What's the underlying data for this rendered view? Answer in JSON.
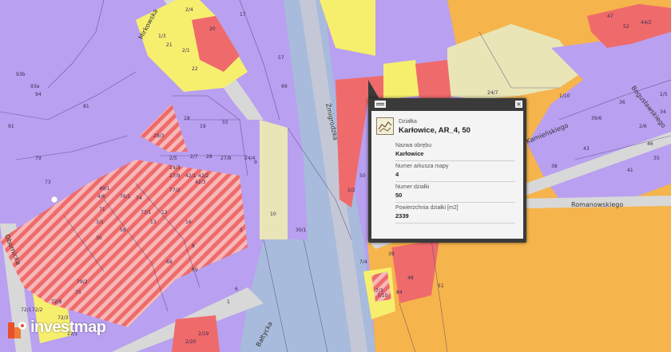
{
  "popup": {
    "kind": "Działka",
    "title": "Karłowice, AR_4, 50",
    "fields": [
      {
        "label": "Nazwa obrębu",
        "value": "Karłowice"
      },
      {
        "label": "Numer arkusza mapy",
        "value": "4"
      },
      {
        "label": "Numer działki",
        "value": "50"
      },
      {
        "label": "Powierzchnia działki [m2]",
        "value": "2339"
      }
    ],
    "close_glyph": "×"
  },
  "logo": {
    "brand": "investmap"
  },
  "streets": {
    "mirkowska": "Mirkowska",
    "zmigrodzka": "Żmigrodzka",
    "kamienskiego": "Kamieńskiego",
    "boguslawskiego": "Bogusławskiego",
    "romanowskiego": "Romanowskiego",
    "obornicka": "Obornicka",
    "baltycka": "Bałtycka"
  },
  "parcel_labels": [
    "2/4",
    "1/3",
    "20",
    "17",
    "21",
    "22",
    "2/1",
    "57",
    "69",
    "93b",
    "93a",
    "94",
    "81",
    "91",
    "79",
    "73",
    "72/2",
    "72/1",
    "7/3",
    "18",
    "19",
    "29/3",
    "55",
    "2/5",
    "2/7",
    "28",
    "27/8",
    "24/4",
    "24/3",
    "27/9",
    "42/1",
    "42/2",
    "42/3",
    "49/1",
    "4/6",
    "76/1",
    "74",
    "71",
    "77/1",
    "77/2",
    "12",
    "13",
    "16",
    "8",
    "3/1",
    "58",
    "30",
    "68",
    "89",
    "6",
    "1",
    "5",
    "9",
    "10",
    "30/1",
    "7/10",
    "79/2",
    "75",
    "72/8",
    "72/3",
    "22/1",
    "2/19",
    "2/20",
    "84",
    "48",
    "39",
    "7/4",
    "2/2",
    "50",
    "51",
    "52",
    "47",
    "44/2",
    "1/10",
    "39/6",
    "36",
    "38",
    "43",
    "41",
    "46",
    "2/6",
    "35",
    "34",
    "2/5",
    "24/7"
  ],
  "colors": {
    "residential": "#b9a0f0",
    "service": "#f6ef6e",
    "commercial": "#ef6b6b",
    "industrial": "#f6b44c",
    "green": "#e9e5b6",
    "road": "#c4c8d6",
    "railway": "#a8bbdc",
    "hatched": "#f08a8a"
  }
}
